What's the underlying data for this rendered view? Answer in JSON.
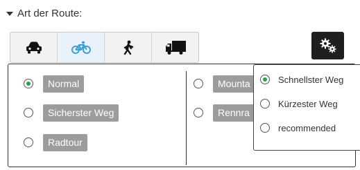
{
  "header": {
    "title": "Art der Route:",
    "icon": "caret-down-icon"
  },
  "modes": [
    {
      "name": "car",
      "icon": "car-icon",
      "active": false
    },
    {
      "name": "bicycle",
      "icon": "bicycle-icon",
      "active": true
    },
    {
      "name": "walk",
      "icon": "pedestrian-icon",
      "active": false
    },
    {
      "name": "truck",
      "icon": "truck-icon",
      "active": false
    }
  ],
  "settings": {
    "icon": "gears-icon"
  },
  "route_options": [
    {
      "label": "Normal",
      "selected": true
    },
    {
      "label": "Sicherster Weg",
      "selected": false
    },
    {
      "label": "Radtour",
      "selected": false
    },
    {
      "label": "Mounta",
      "selected": false
    },
    {
      "label": "Rennra",
      "selected": false
    }
  ],
  "dropdown": [
    {
      "label": "Schnellster Weg",
      "selected": true
    },
    {
      "label": "Kürzester Weg",
      "selected": false
    },
    {
      "label": "recommended",
      "selected": false
    }
  ],
  "colors": {
    "accent": "#2e9e4a",
    "active_mode": "#e9f2fa",
    "active_icon": "#3a9fd8",
    "chip": "#9c9c9c"
  }
}
